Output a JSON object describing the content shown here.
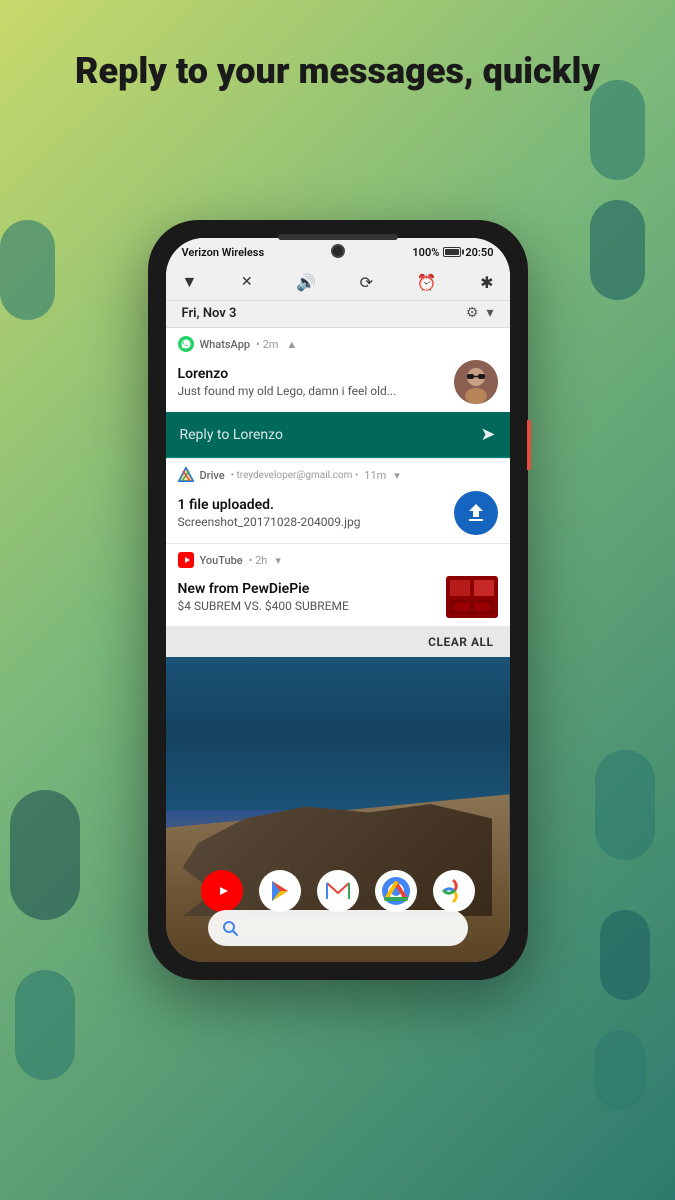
{
  "page": {
    "header": "Reply to your messages, quickly",
    "background_colors": {
      "top": "#c8d96b",
      "mid": "#7ab87a",
      "bottom": "#2d7a6e"
    }
  },
  "phone": {
    "status_bar": {
      "carrier": "Verizon Wireless",
      "battery": "100%",
      "time": "20:50"
    },
    "date_row": {
      "date": "Fri, Nov 3"
    },
    "notifications": [
      {
        "app": "WhatsApp",
        "time": "2m",
        "sender": "Lorenzo",
        "message": "Just found my old Lego, damn i feel old...",
        "reply_placeholder": "Reply to Lorenzo"
      },
      {
        "app": "Drive",
        "account": "treydeveloper@gmail.com",
        "time": "11m",
        "title": "1 file uploaded.",
        "subtitle": "Screenshot_20171028-204009.jpg"
      },
      {
        "app": "YouTube",
        "time": "2h",
        "title": "New from PewDiePie",
        "subtitle": "$4 SUBREM VS. $400 SUBREME"
      }
    ],
    "clear_all_label": "CLEAR ALL",
    "dock_icons": [
      "YouTube",
      "Play Store",
      "Gmail",
      "Chrome",
      "Photos"
    ],
    "nav": {
      "back": "◀",
      "home": "●",
      "recents": "■"
    }
  }
}
